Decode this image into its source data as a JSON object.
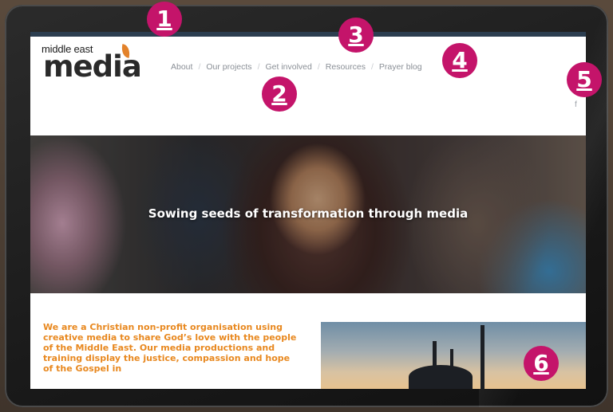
{
  "logo": {
    "small_text": "middle east",
    "big_text": "media",
    "accent": "#e3822a"
  },
  "nav": {
    "items": [
      {
        "label": "About"
      },
      {
        "label": "Our projects"
      },
      {
        "label": "Get involved"
      },
      {
        "label": "Resources"
      },
      {
        "label": "Prayer blog"
      }
    ],
    "separator": "/"
  },
  "social": {
    "facebook": "f"
  },
  "hero": {
    "tagline": "Sowing seeds of transformation through media"
  },
  "intro": {
    "text": "We are a Christian non-profit organisation using creative media to share God’s love with the people of the Middle East. Our media productions and training display the justice, compassion and hope of the Gospel in"
  },
  "callouts": {
    "color": "#c4146a",
    "numbers": [
      "1",
      "2",
      "3",
      "4",
      "5",
      "6"
    ]
  }
}
